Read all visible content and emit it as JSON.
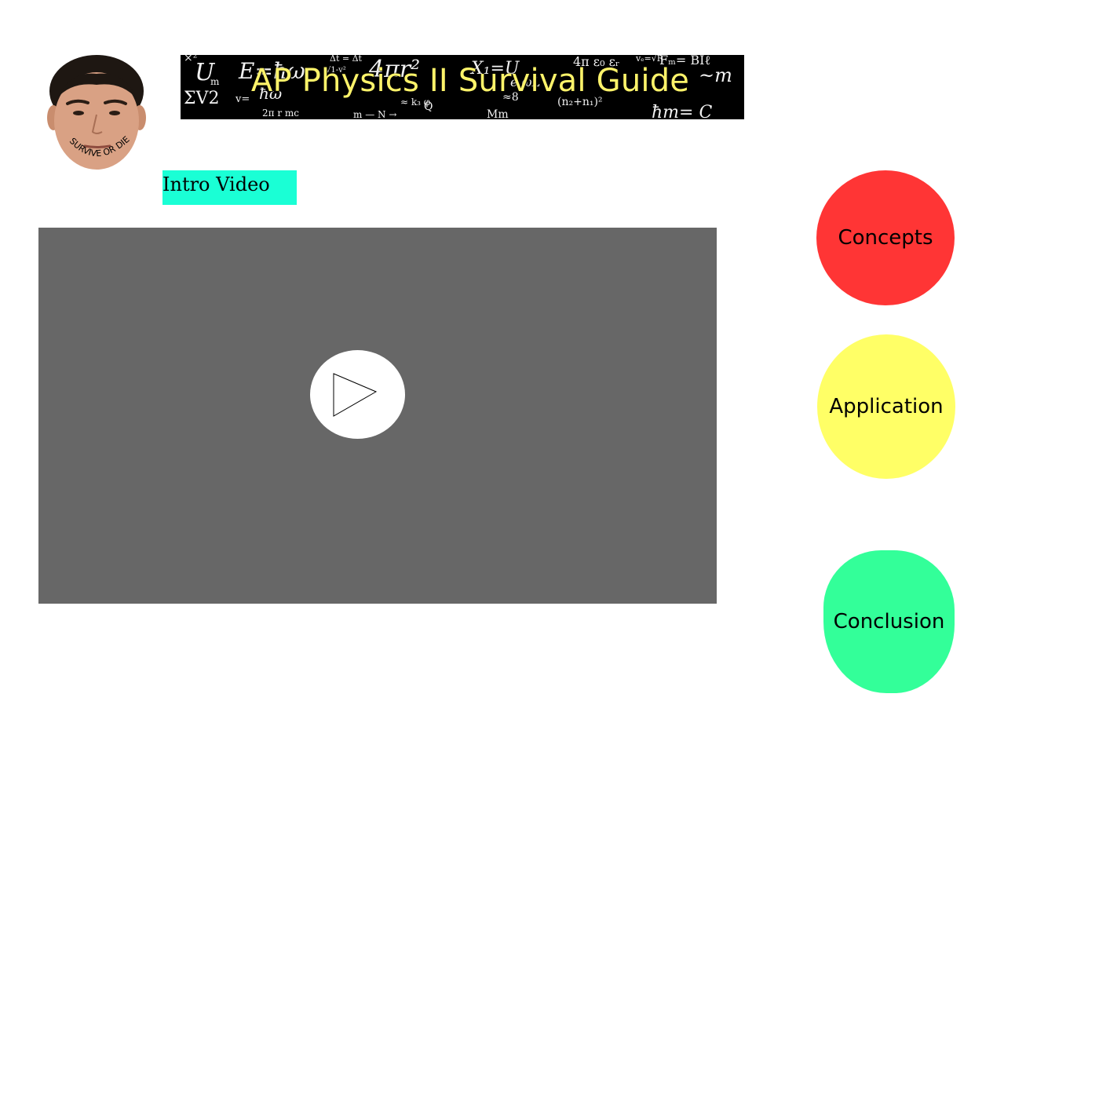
{
  "header": {
    "title": "AP Physics II Survival Guide",
    "avatar_caption": "SURVIVE OR DIE"
  },
  "intro": {
    "label": "Intro Video"
  },
  "video": {
    "play_icon": "play-icon"
  },
  "nav": {
    "concepts": "Concepts",
    "application": "Application",
    "conclusion": "Conclusion"
  },
  "colors": {
    "banner_bg": "#000000",
    "banner_text": "#fdf36a",
    "intro_bg": "#1affd5",
    "video_bg": "#676767",
    "concepts": "#ff3535",
    "application": "#ffff66",
    "conclusion": "#33ff99"
  }
}
